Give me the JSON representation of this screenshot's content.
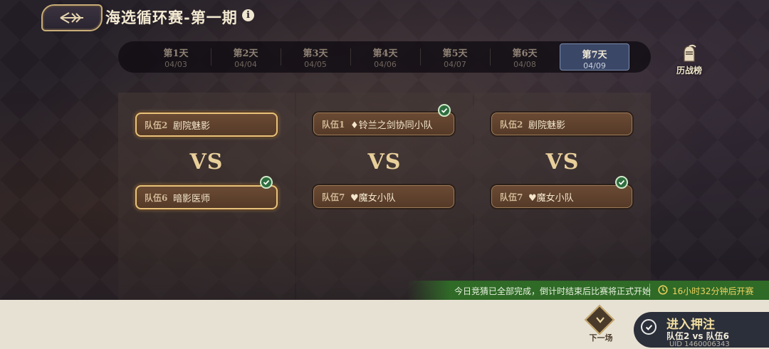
{
  "header": {
    "title": "海选循环赛-第一期",
    "info": "i"
  },
  "tabs": [
    {
      "label": "第1天",
      "date": "04/03"
    },
    {
      "label": "第2天",
      "date": "04/04"
    },
    {
      "label": "第3天",
      "date": "04/05"
    },
    {
      "label": "第4天",
      "date": "04/06"
    },
    {
      "label": "第5天",
      "date": "04/07"
    },
    {
      "label": "第6天",
      "date": "04/08"
    },
    {
      "label": "第7天",
      "date": "04/09"
    }
  ],
  "active_tab": 6,
  "history_label": "历战榜",
  "matches": [
    {
      "team1": {
        "tag": "队伍2",
        "name": "剧院魅影"
      },
      "vs": "VS",
      "team2": {
        "tag": "队伍6",
        "name": "暗影医师"
      }
    },
    {
      "team1": {
        "tag": "队伍1",
        "name": "♦铃兰之剑协同小队"
      },
      "vs": "VS",
      "team2": {
        "tag": "队伍7",
        "name": "♥魔女小队"
      }
    },
    {
      "team1": {
        "tag": "队伍2",
        "name": "剧院魅影"
      },
      "vs": "VS",
      "team2": {
        "tag": "队伍7",
        "name": "♥魔女小队"
      }
    }
  ],
  "status": {
    "message": "今日竞猜已全部完成，倒计时结束后比赛将正式开始",
    "countdown": "16小时32分钟后开赛"
  },
  "footer": {
    "next_label": "下一场",
    "enter_title": "进入押注",
    "enter_sub": "队伍2 vs 队伍6",
    "uid": "UID 1460006343"
  }
}
